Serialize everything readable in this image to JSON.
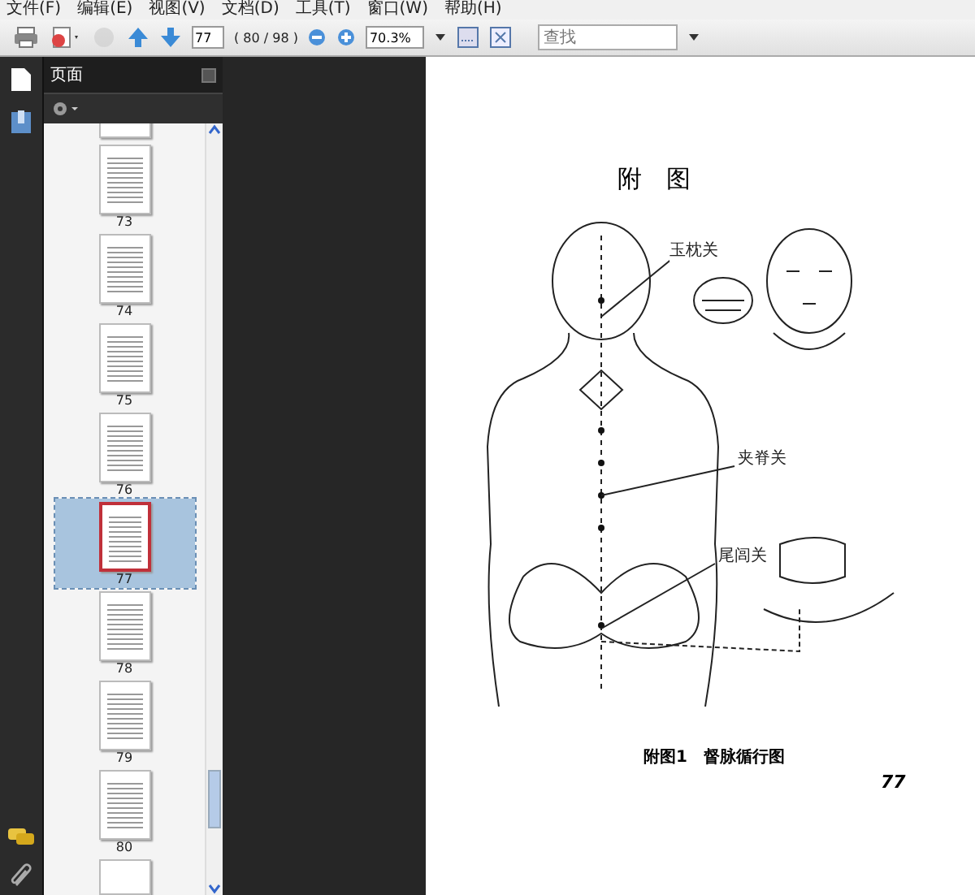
{
  "menu": [
    {
      "label": "文件(F)"
    },
    {
      "label": "编辑(E)"
    },
    {
      "label": "视图(V)"
    },
    {
      "label": "文档(D)"
    },
    {
      "label": "工具(T)"
    },
    {
      "label": "窗口(W)"
    },
    {
      "label": "帮助(H)"
    }
  ],
  "toolbar": {
    "page_field": "77",
    "page_count": "( 80 / 98 )",
    "zoom": "70.3%",
    "search_placeholder": "查找"
  },
  "sidebar": {
    "title": "页面",
    "thumbnails": [
      {
        "label": "73",
        "selected": false
      },
      {
        "label": "74",
        "selected": false
      },
      {
        "label": "75",
        "selected": false
      },
      {
        "label": "76",
        "selected": false
      },
      {
        "label": "77",
        "selected": true
      },
      {
        "label": "78",
        "selected": false
      },
      {
        "label": "79",
        "selected": false
      },
      {
        "label": "80",
        "selected": false
      }
    ]
  },
  "page": {
    "heading": "附　图",
    "labels": [
      "玉枕关",
      "夹脊关",
      "尾闾关"
    ],
    "caption": "附图1　督脉循行图",
    "page_number": "77"
  }
}
